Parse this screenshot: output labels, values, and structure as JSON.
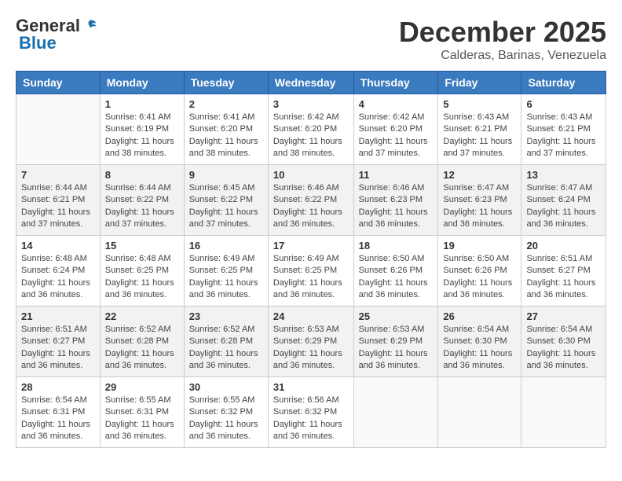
{
  "logo": {
    "general": "General",
    "blue": "Blue"
  },
  "title": "December 2025",
  "location": "Calderas, Barinas, Venezuela",
  "days_of_week": [
    "Sunday",
    "Monday",
    "Tuesday",
    "Wednesday",
    "Thursday",
    "Friday",
    "Saturday"
  ],
  "weeks": [
    [
      {
        "day": "",
        "sunrise": "",
        "sunset": "",
        "daylight": ""
      },
      {
        "day": "1",
        "sunrise": "Sunrise: 6:41 AM",
        "sunset": "Sunset: 6:19 PM",
        "daylight": "Daylight: 11 hours and 38 minutes."
      },
      {
        "day": "2",
        "sunrise": "Sunrise: 6:41 AM",
        "sunset": "Sunset: 6:20 PM",
        "daylight": "Daylight: 11 hours and 38 minutes."
      },
      {
        "day": "3",
        "sunrise": "Sunrise: 6:42 AM",
        "sunset": "Sunset: 6:20 PM",
        "daylight": "Daylight: 11 hours and 38 minutes."
      },
      {
        "day": "4",
        "sunrise": "Sunrise: 6:42 AM",
        "sunset": "Sunset: 6:20 PM",
        "daylight": "Daylight: 11 hours and 37 minutes."
      },
      {
        "day": "5",
        "sunrise": "Sunrise: 6:43 AM",
        "sunset": "Sunset: 6:21 PM",
        "daylight": "Daylight: 11 hours and 37 minutes."
      },
      {
        "day": "6",
        "sunrise": "Sunrise: 6:43 AM",
        "sunset": "Sunset: 6:21 PM",
        "daylight": "Daylight: 11 hours and 37 minutes."
      }
    ],
    [
      {
        "day": "7",
        "sunrise": "Sunrise: 6:44 AM",
        "sunset": "Sunset: 6:21 PM",
        "daylight": "Daylight: 11 hours and 37 minutes."
      },
      {
        "day": "8",
        "sunrise": "Sunrise: 6:44 AM",
        "sunset": "Sunset: 6:22 PM",
        "daylight": "Daylight: 11 hours and 37 minutes."
      },
      {
        "day": "9",
        "sunrise": "Sunrise: 6:45 AM",
        "sunset": "Sunset: 6:22 PM",
        "daylight": "Daylight: 11 hours and 37 minutes."
      },
      {
        "day": "10",
        "sunrise": "Sunrise: 6:46 AM",
        "sunset": "Sunset: 6:22 PM",
        "daylight": "Daylight: 11 hours and 36 minutes."
      },
      {
        "day": "11",
        "sunrise": "Sunrise: 6:46 AM",
        "sunset": "Sunset: 6:23 PM",
        "daylight": "Daylight: 11 hours and 36 minutes."
      },
      {
        "day": "12",
        "sunrise": "Sunrise: 6:47 AM",
        "sunset": "Sunset: 6:23 PM",
        "daylight": "Daylight: 11 hours and 36 minutes."
      },
      {
        "day": "13",
        "sunrise": "Sunrise: 6:47 AM",
        "sunset": "Sunset: 6:24 PM",
        "daylight": "Daylight: 11 hours and 36 minutes."
      }
    ],
    [
      {
        "day": "14",
        "sunrise": "Sunrise: 6:48 AM",
        "sunset": "Sunset: 6:24 PM",
        "daylight": "Daylight: 11 hours and 36 minutes."
      },
      {
        "day": "15",
        "sunrise": "Sunrise: 6:48 AM",
        "sunset": "Sunset: 6:25 PM",
        "daylight": "Daylight: 11 hours and 36 minutes."
      },
      {
        "day": "16",
        "sunrise": "Sunrise: 6:49 AM",
        "sunset": "Sunset: 6:25 PM",
        "daylight": "Daylight: 11 hours and 36 minutes."
      },
      {
        "day": "17",
        "sunrise": "Sunrise: 6:49 AM",
        "sunset": "Sunset: 6:25 PM",
        "daylight": "Daylight: 11 hours and 36 minutes."
      },
      {
        "day": "18",
        "sunrise": "Sunrise: 6:50 AM",
        "sunset": "Sunset: 6:26 PM",
        "daylight": "Daylight: 11 hours and 36 minutes."
      },
      {
        "day": "19",
        "sunrise": "Sunrise: 6:50 AM",
        "sunset": "Sunset: 6:26 PM",
        "daylight": "Daylight: 11 hours and 36 minutes."
      },
      {
        "day": "20",
        "sunrise": "Sunrise: 6:51 AM",
        "sunset": "Sunset: 6:27 PM",
        "daylight": "Daylight: 11 hours and 36 minutes."
      }
    ],
    [
      {
        "day": "21",
        "sunrise": "Sunrise: 6:51 AM",
        "sunset": "Sunset: 6:27 PM",
        "daylight": "Daylight: 11 hours and 36 minutes."
      },
      {
        "day": "22",
        "sunrise": "Sunrise: 6:52 AM",
        "sunset": "Sunset: 6:28 PM",
        "daylight": "Daylight: 11 hours and 36 minutes."
      },
      {
        "day": "23",
        "sunrise": "Sunrise: 6:52 AM",
        "sunset": "Sunset: 6:28 PM",
        "daylight": "Daylight: 11 hours and 36 minutes."
      },
      {
        "day": "24",
        "sunrise": "Sunrise: 6:53 AM",
        "sunset": "Sunset: 6:29 PM",
        "daylight": "Daylight: 11 hours and 36 minutes."
      },
      {
        "day": "25",
        "sunrise": "Sunrise: 6:53 AM",
        "sunset": "Sunset: 6:29 PM",
        "daylight": "Daylight: 11 hours and 36 minutes."
      },
      {
        "day": "26",
        "sunrise": "Sunrise: 6:54 AM",
        "sunset": "Sunset: 6:30 PM",
        "daylight": "Daylight: 11 hours and 36 minutes."
      },
      {
        "day": "27",
        "sunrise": "Sunrise: 6:54 AM",
        "sunset": "Sunset: 6:30 PM",
        "daylight": "Daylight: 11 hours and 36 minutes."
      }
    ],
    [
      {
        "day": "28",
        "sunrise": "Sunrise: 6:54 AM",
        "sunset": "Sunset: 6:31 PM",
        "daylight": "Daylight: 11 hours and 36 minutes."
      },
      {
        "day": "29",
        "sunrise": "Sunrise: 6:55 AM",
        "sunset": "Sunset: 6:31 PM",
        "daylight": "Daylight: 11 hours and 36 minutes."
      },
      {
        "day": "30",
        "sunrise": "Sunrise: 6:55 AM",
        "sunset": "Sunset: 6:32 PM",
        "daylight": "Daylight: 11 hours and 36 minutes."
      },
      {
        "day": "31",
        "sunrise": "Sunrise: 6:56 AM",
        "sunset": "Sunset: 6:32 PM",
        "daylight": "Daylight: 11 hours and 36 minutes."
      },
      {
        "day": "",
        "sunrise": "",
        "sunset": "",
        "daylight": ""
      },
      {
        "day": "",
        "sunrise": "",
        "sunset": "",
        "daylight": ""
      },
      {
        "day": "",
        "sunrise": "",
        "sunset": "",
        "daylight": ""
      }
    ]
  ]
}
